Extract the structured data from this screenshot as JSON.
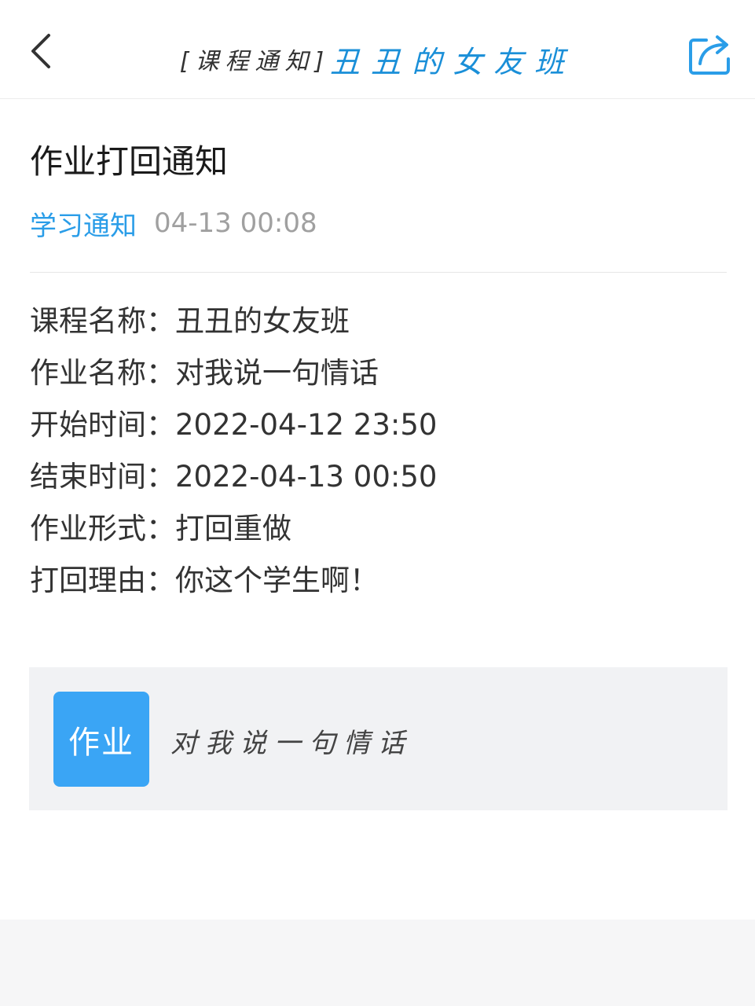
{
  "header": {
    "back_icon": "chevron-left-icon",
    "title_prefix": "[课程通知]",
    "title_course": "丑丑的女友班",
    "share_icon": "share-icon",
    "accent_color": "#1a8fd8"
  },
  "notice": {
    "title": "作业打回通知",
    "category": "学习通知",
    "time": "04-13 00:08"
  },
  "details": [
    {
      "label": "课程名称：",
      "value": "丑丑的女友班"
    },
    {
      "label": "作业名称：",
      "value": "对我说一句情话"
    },
    {
      "label": "开始时间：",
      "value": "2022-04-12 23:50"
    },
    {
      "label": "结束时间：",
      "value": "2022-04-13 00:50"
    },
    {
      "label": "作业形式：",
      "value": "打回重做"
    },
    {
      "label": "打回理由：",
      "value": "你这个学生啊！"
    }
  ],
  "homework_card": {
    "badge": "作业",
    "name": "对我说一句情话",
    "badge_color": "#3aa5f5"
  }
}
